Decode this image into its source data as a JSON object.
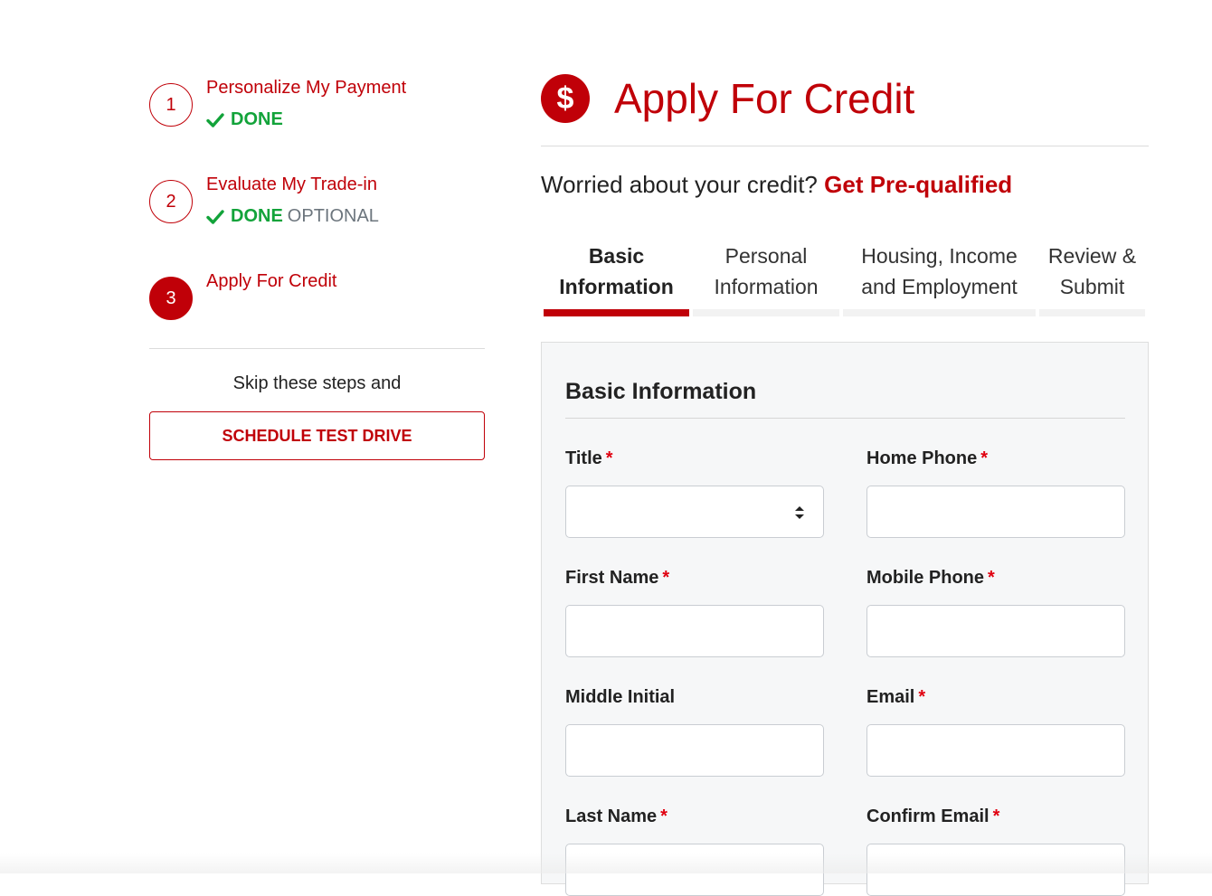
{
  "steps": [
    {
      "number": "1",
      "title": "Personalize My Payment",
      "status": "DONE",
      "optional": ""
    },
    {
      "number": "2",
      "title": "Evaluate My Trade-in",
      "status": "DONE",
      "optional": "OPTIONAL"
    },
    {
      "number": "3",
      "title": "Apply For Credit",
      "status": "",
      "optional": ""
    }
  ],
  "sidebar": {
    "skip_text": "Skip these steps and",
    "test_drive_label": "SCHEDULE TEST DRIVE"
  },
  "header": {
    "icon_symbol": "$",
    "title": "Apply For Credit"
  },
  "prequal": {
    "text": "Worried about your credit?",
    "link": "Get Pre-qualified"
  },
  "tabs": [
    {
      "line1": "Basic",
      "line2": "Information",
      "active": true
    },
    {
      "line1": "Personal",
      "line2": "Information",
      "active": false
    },
    {
      "line1": "Housing, Income",
      "line2": "and Employment",
      "active": false
    },
    {
      "line1": "Review &",
      "line2": "Submit",
      "active": false
    }
  ],
  "form": {
    "section_title": "Basic Information",
    "required_marker": "*",
    "fields": {
      "title": {
        "label": "Title",
        "value": ""
      },
      "home_phone": {
        "label": "Home Phone",
        "value": ""
      },
      "first_name": {
        "label": "First Name",
        "value": ""
      },
      "mobile_phone": {
        "label": "Mobile Phone",
        "value": ""
      },
      "middle_initial": {
        "label": "Middle Initial",
        "value": ""
      },
      "email": {
        "label": "Email",
        "value": ""
      },
      "last_name": {
        "label": "Last Name",
        "value": ""
      },
      "confirm_email": {
        "label": "Confirm Email",
        "value": ""
      }
    }
  },
  "colors": {
    "brand_red": "#c00008",
    "done_green": "#12a33a",
    "optional_gray": "#6c757d",
    "required_red": "#e00010"
  },
  "icons": {
    "check": "check-icon",
    "dollar": "dollar-circle-icon",
    "select": "select-arrows-icon"
  }
}
